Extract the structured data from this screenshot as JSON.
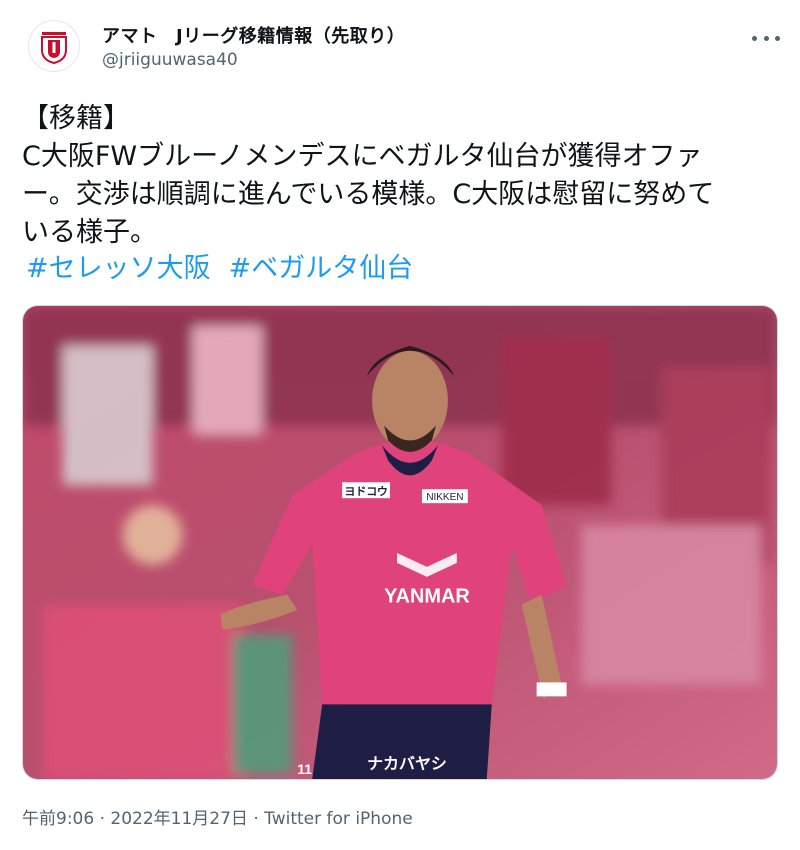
{
  "account": {
    "display_name": "アマト　Jリーグ移籍情報（先取り）",
    "handle": "@jriiguuwasa40",
    "avatar_icon": "jleague-logo-icon"
  },
  "tweet": {
    "lines": [
      "【移籍】",
      "C大阪FWブルーノメンデスにベガルタ仙台が獲得オファ",
      "ー。交渉は順調に進んでいる模様。C大阪は慰留に努めて",
      "いる様子。"
    ],
    "hashtags": [
      "#セレッソ大阪",
      "#ベガルタ仙台"
    ]
  },
  "media": {
    "kind": "photo",
    "jersey_sponsor": "YANMAR",
    "jersey_badge": "ヨドコウ",
    "jersey_sleeve": "NIKKEN",
    "shorts_text": "ナカバヤシ",
    "number": "11"
  },
  "footer": {
    "time": "午前9:06",
    "separator": "·",
    "date": "2022年11月27日",
    "client": "Twitter for iPhone"
  },
  "colors": {
    "link": "#1d9bf0",
    "secondary_text": "#536471",
    "jersey_pink": "#e0427c",
    "jersey_navy": "#1e1e45"
  }
}
